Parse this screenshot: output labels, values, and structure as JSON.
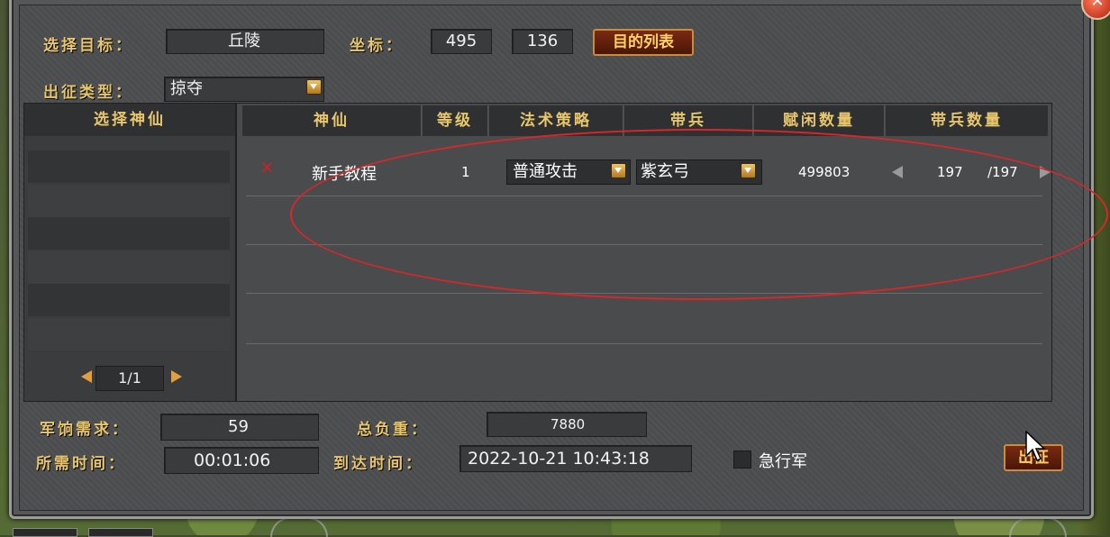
{
  "header": {
    "target_label": "选择目标：",
    "target_value": "丘陵",
    "coord_label": "坐标：",
    "coord_x": "495",
    "coord_y": "136",
    "target_list_button": "目的列表",
    "expedition_type_label": "出征类型：",
    "expedition_type_value": "掠夺"
  },
  "god_list": {
    "header": "选择神仙",
    "page": "1/1"
  },
  "table": {
    "columns": [
      "神仙",
      "等级",
      "法术策略",
      "带兵",
      "赋闲数量",
      "带兵数量"
    ],
    "rows": [
      {
        "remove_icon": "✕",
        "name": "新手教程",
        "level": "1",
        "strategy": "普通攻击",
        "troop": "紫玄弓",
        "idle_count": "499803",
        "troop_count": "197",
        "troop_max": "/197"
      }
    ]
  },
  "footer": {
    "food_label": "军饷需求：",
    "food_value": "59",
    "load_label": "总负重：",
    "load_value": "7880",
    "time_label": "所需时间：",
    "time_value": "00:01:06",
    "arrival_label": "到达时间：",
    "arrival_value": "2022-10-21 10:43:18",
    "forced_march_label": "急行军",
    "depart_button": "出征"
  },
  "colors": {
    "label_gold": "#e8c66c",
    "annotation_red": "#d8272a",
    "button_orange_border": "#c98b3d"
  }
}
